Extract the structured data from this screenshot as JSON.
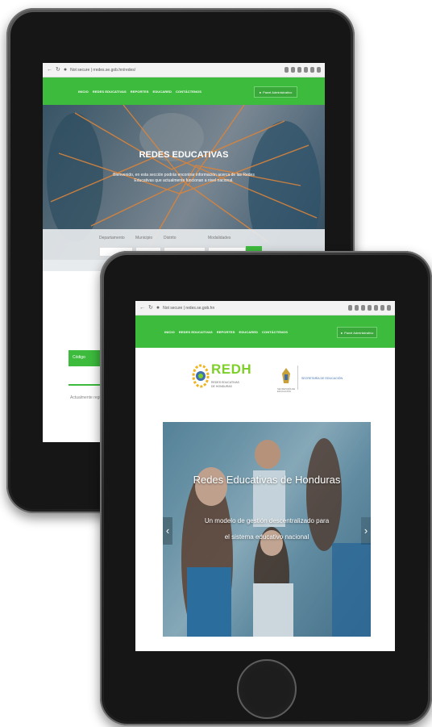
{
  "back_tablet": {
    "url": "Not secure  |  rredes.se.gob.hn/redes/",
    "menu": [
      "INICIO",
      "REDES EDUCATIVAS",
      "REPORTES",
      "EDUCARED",
      "CONTÁCTENOS"
    ],
    "admin_button": "Panel Administrativo",
    "hero_title": "REDES EDUCATIVAS",
    "hero_subtitle": "Bienvenido, en esta sección podrás encontrar información acerca de las Redes Educativas que actualmente funcionan a nivel nacional.",
    "search_labels": [
      "Departamento",
      "Municipio",
      "Distrito",
      "Modalidades"
    ],
    "table_header": "Código",
    "empty_text": "Actualmente registrados"
  },
  "front_tablet": {
    "url": "Not secure  |  redes.se.gob.hn",
    "menu": [
      "INICIO",
      "REDES EDUCATIVAS",
      "REPORTES",
      "EDUCARED",
      "CONTÁCTENOS"
    ],
    "admin_button": "Panel Administrativo",
    "logo_text": "REDH",
    "logo_subtitle": "REDES EDUCATIVAS DE HONDURAS",
    "gov_caption_1": "SECRETARÍA DE EDUCACIÓN",
    "gov_caption_2": "SECRETARÍA DE EDUCACIÓN",
    "slide_title": "Redes Educativas de Honduras",
    "slide_subtitle_1": "Un modelo de gestión descentralizado para",
    "slide_subtitle_2": "el sistema educativo nacional",
    "prev_icon": "‹",
    "next_icon": "›"
  },
  "colors": {
    "accent_green": "#3dbb3d",
    "logo_green": "#7fcf2a",
    "gov_blue": "#3d6fb0",
    "device": "#2b2b2b"
  }
}
